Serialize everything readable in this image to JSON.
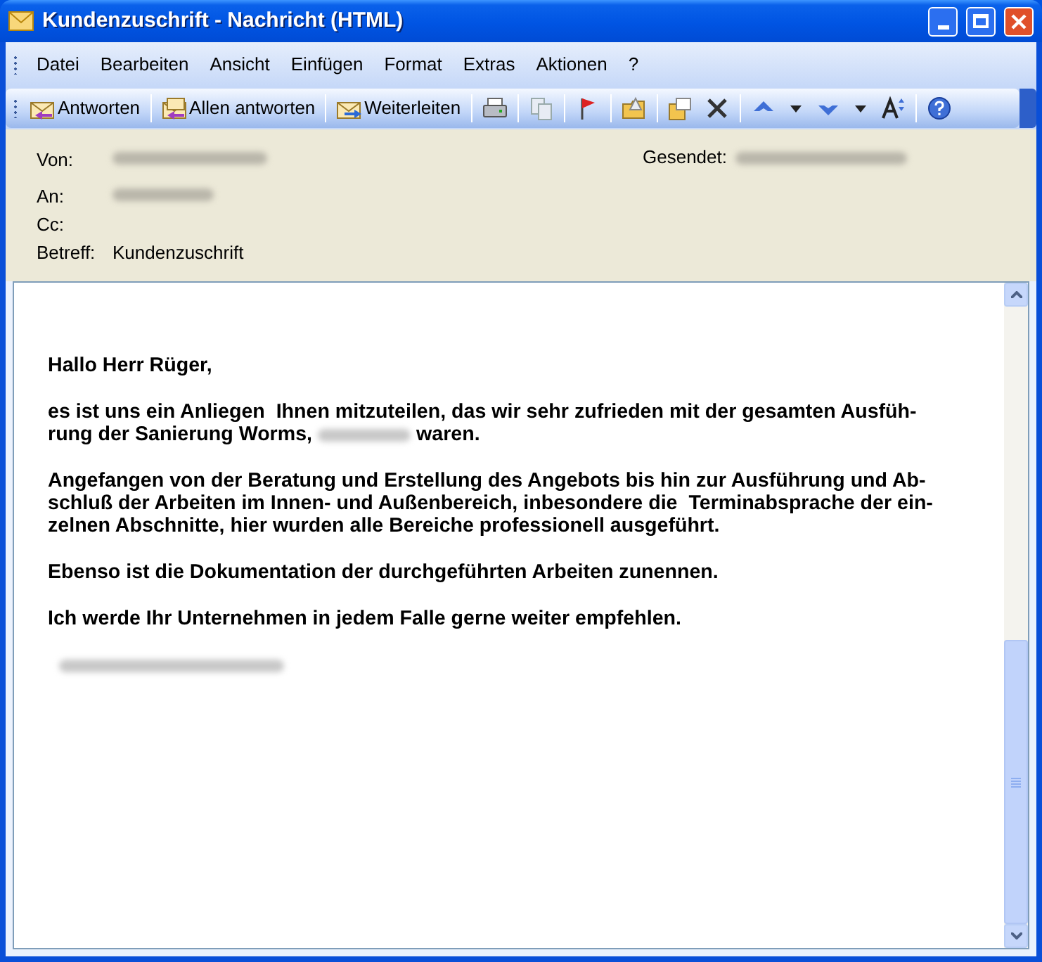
{
  "window": {
    "title": "Kundenzuschrift - Nachricht (HTML)"
  },
  "menu": [
    "Datei",
    "Bearbeiten",
    "Ansicht",
    "Einfügen",
    "Format",
    "Extras",
    "Aktionen",
    "?"
  ],
  "toolbar": {
    "buttons": [
      {
        "label": "Antworten"
      },
      {
        "label": "Allen antworten"
      },
      {
        "label": "Weiterleiten"
      }
    ]
  },
  "header": {
    "fields": [
      {
        "label": "Von:",
        "redacted": true
      },
      {
        "label": "An:",
        "redacted": true
      },
      {
        "label": "Cc:",
        "redacted": false
      },
      {
        "label": "Betreff:",
        "value": "Kundenzuschrift",
        "redacted": false
      }
    ],
    "sent": {
      "label": "Gesendet:",
      "redacted": true
    }
  },
  "body": {
    "paragraphs": [
      {
        "kind": "text",
        "lines": [
          "Hallo Herr Rüger,"
        ]
      },
      {
        "kind": "text",
        "lines": [
          "es ist uns ein Anliegen  Ihnen mitzuteilen, das wir sehr zufrieden mit der gesamten Ausfüh-",
          {
            "before": "rung der Sanierung Worms,",
            "after": "waren.",
            "redacted": true
          }
        ]
      },
      {
        "kind": "text",
        "lines": [
          "Angefangen von der Beratung und Erstellung des Angebots bis hin zur Ausführung und Ab-",
          "schluß der Arbeiten im Innen- und Außenbereich, inbesondere die  Terminabsprache der ein-",
          "zelnen Abschnitte, hier wurden alle Bereiche professionell ausgeführt."
        ]
      },
      {
        "kind": "text",
        "lines": [
          "Ebenso ist die Dokumentation der durchgeführten Arbeiten zunennen."
        ]
      },
      {
        "kind": "text",
        "lines": [
          "Ich werde Ihr Unternehmen in jedem Falle gerne weiter empfehlen."
        ]
      },
      {
        "kind": "redacted"
      }
    ]
  }
}
